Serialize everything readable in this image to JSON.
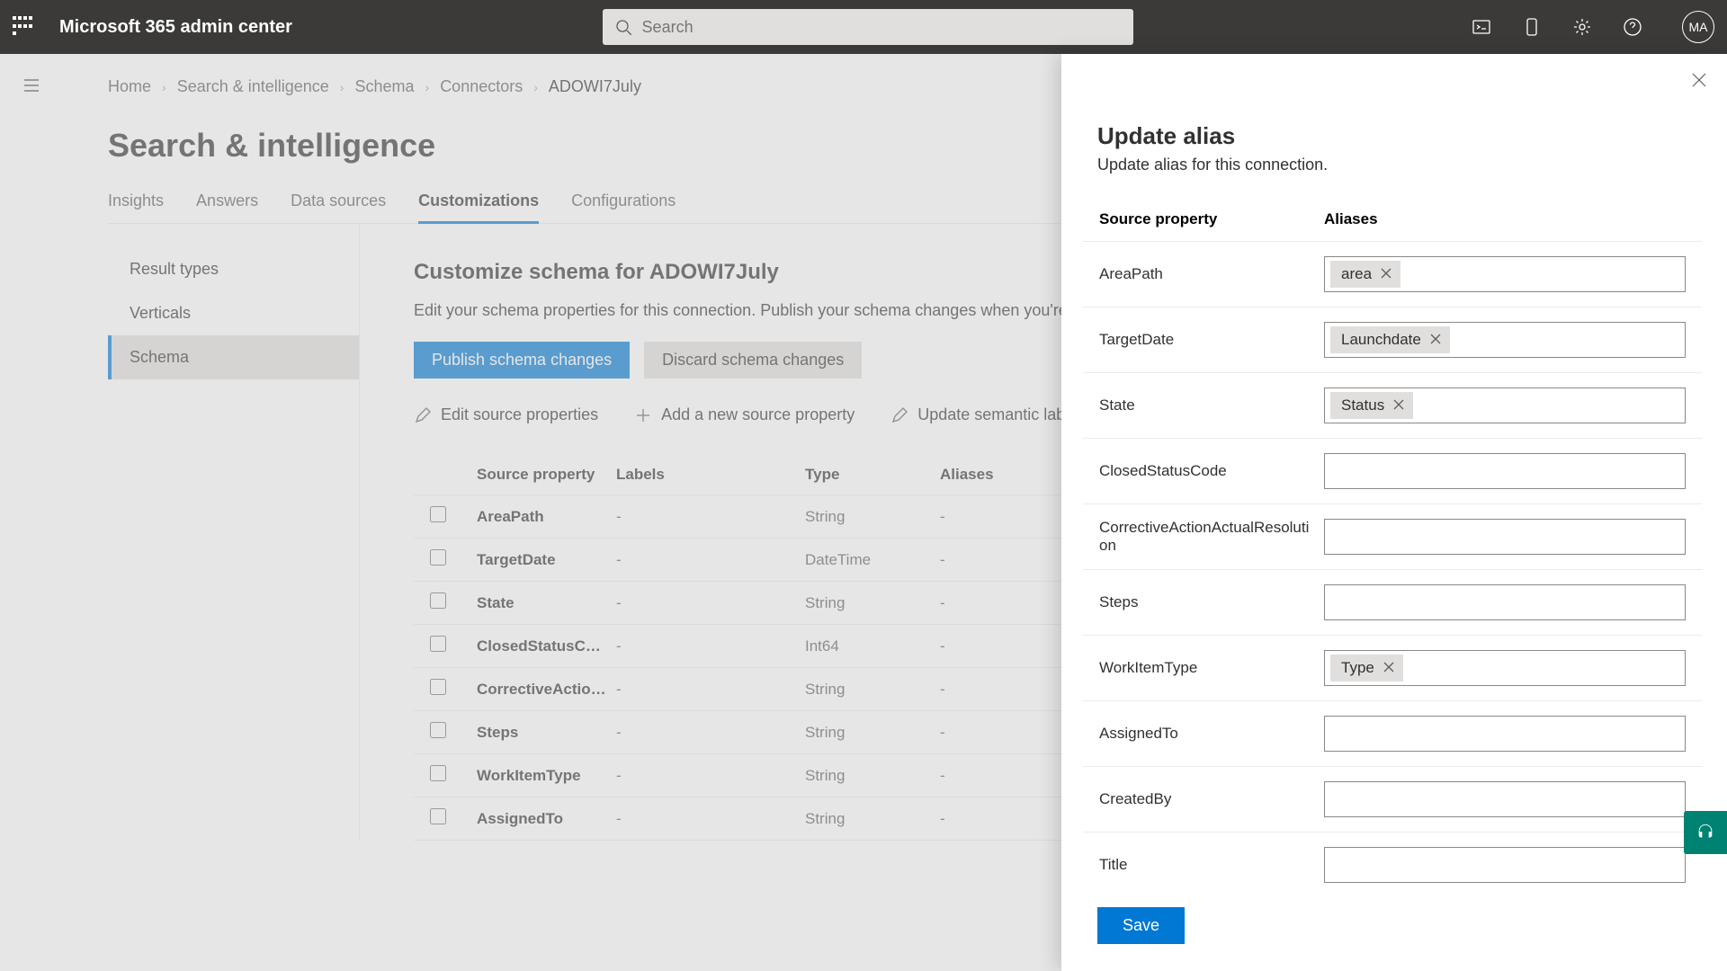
{
  "header": {
    "app_title": "Microsoft 365 admin center",
    "search_placeholder": "Search",
    "avatar_initials": "MA"
  },
  "breadcrumb": {
    "items": [
      "Home",
      "Search & intelligence",
      "Schema",
      "Connectors"
    ],
    "current": "ADOWI7July"
  },
  "page": {
    "title": "Search & intelligence"
  },
  "tabs": [
    "Insights",
    "Answers",
    "Data sources",
    "Customizations",
    "Configurations"
  ],
  "active_tab": "Customizations",
  "sidebar": {
    "items": [
      "Result types",
      "Verticals",
      "Schema"
    ],
    "active": "Schema"
  },
  "main": {
    "heading": "Customize schema for ADOWI7July",
    "desc": "Edit your schema properties for this connection. Publish your schema changes when you're done.",
    "publish_btn": "Publish schema changes",
    "discard_btn": "Discard schema changes",
    "actions": {
      "edit_src": "Edit source properties",
      "add_src": "Add a new source property",
      "update_labels": "Update semantic labels"
    },
    "columns": {
      "src": "Source property",
      "labels": "Labels",
      "type": "Type",
      "aliases": "Aliases"
    },
    "rows": [
      {
        "src": "AreaPath",
        "labels": "-",
        "type": "String",
        "aliases": "-"
      },
      {
        "src": "TargetDate",
        "labels": "-",
        "type": "DateTime",
        "aliases": "-"
      },
      {
        "src": "State",
        "labels": "-",
        "type": "String",
        "aliases": "-"
      },
      {
        "src": "ClosedStatusCode",
        "labels": "-",
        "type": "Int64",
        "aliases": "-"
      },
      {
        "src": "CorrectiveActio…",
        "labels": "-",
        "type": "String",
        "aliases": "-"
      },
      {
        "src": "Steps",
        "labels": "-",
        "type": "String",
        "aliases": "-"
      },
      {
        "src": "WorkItemType",
        "labels": "-",
        "type": "String",
        "aliases": "-"
      },
      {
        "src": "AssignedTo",
        "labels": "-",
        "type": "String",
        "aliases": "-"
      }
    ]
  },
  "panel": {
    "title": "Update alias",
    "subtitle": "Update alias for this connection.",
    "col_src": "Source property",
    "col_alias": "Aliases",
    "rows": [
      {
        "src": "AreaPath",
        "chips": [
          "area"
        ]
      },
      {
        "src": "TargetDate",
        "chips": [
          "Launchdate"
        ]
      },
      {
        "src": "State",
        "chips": [
          "Status"
        ]
      },
      {
        "src": "ClosedStatusCode",
        "chips": []
      },
      {
        "src": "CorrectiveActionActualResolution",
        "chips": []
      },
      {
        "src": "Steps",
        "chips": []
      },
      {
        "src": "WorkItemType",
        "chips": [
          "Type"
        ]
      },
      {
        "src": "AssignedTo",
        "chips": []
      },
      {
        "src": "CreatedBy",
        "chips": []
      },
      {
        "src": "Title",
        "chips": []
      }
    ],
    "save_btn": "Save"
  }
}
